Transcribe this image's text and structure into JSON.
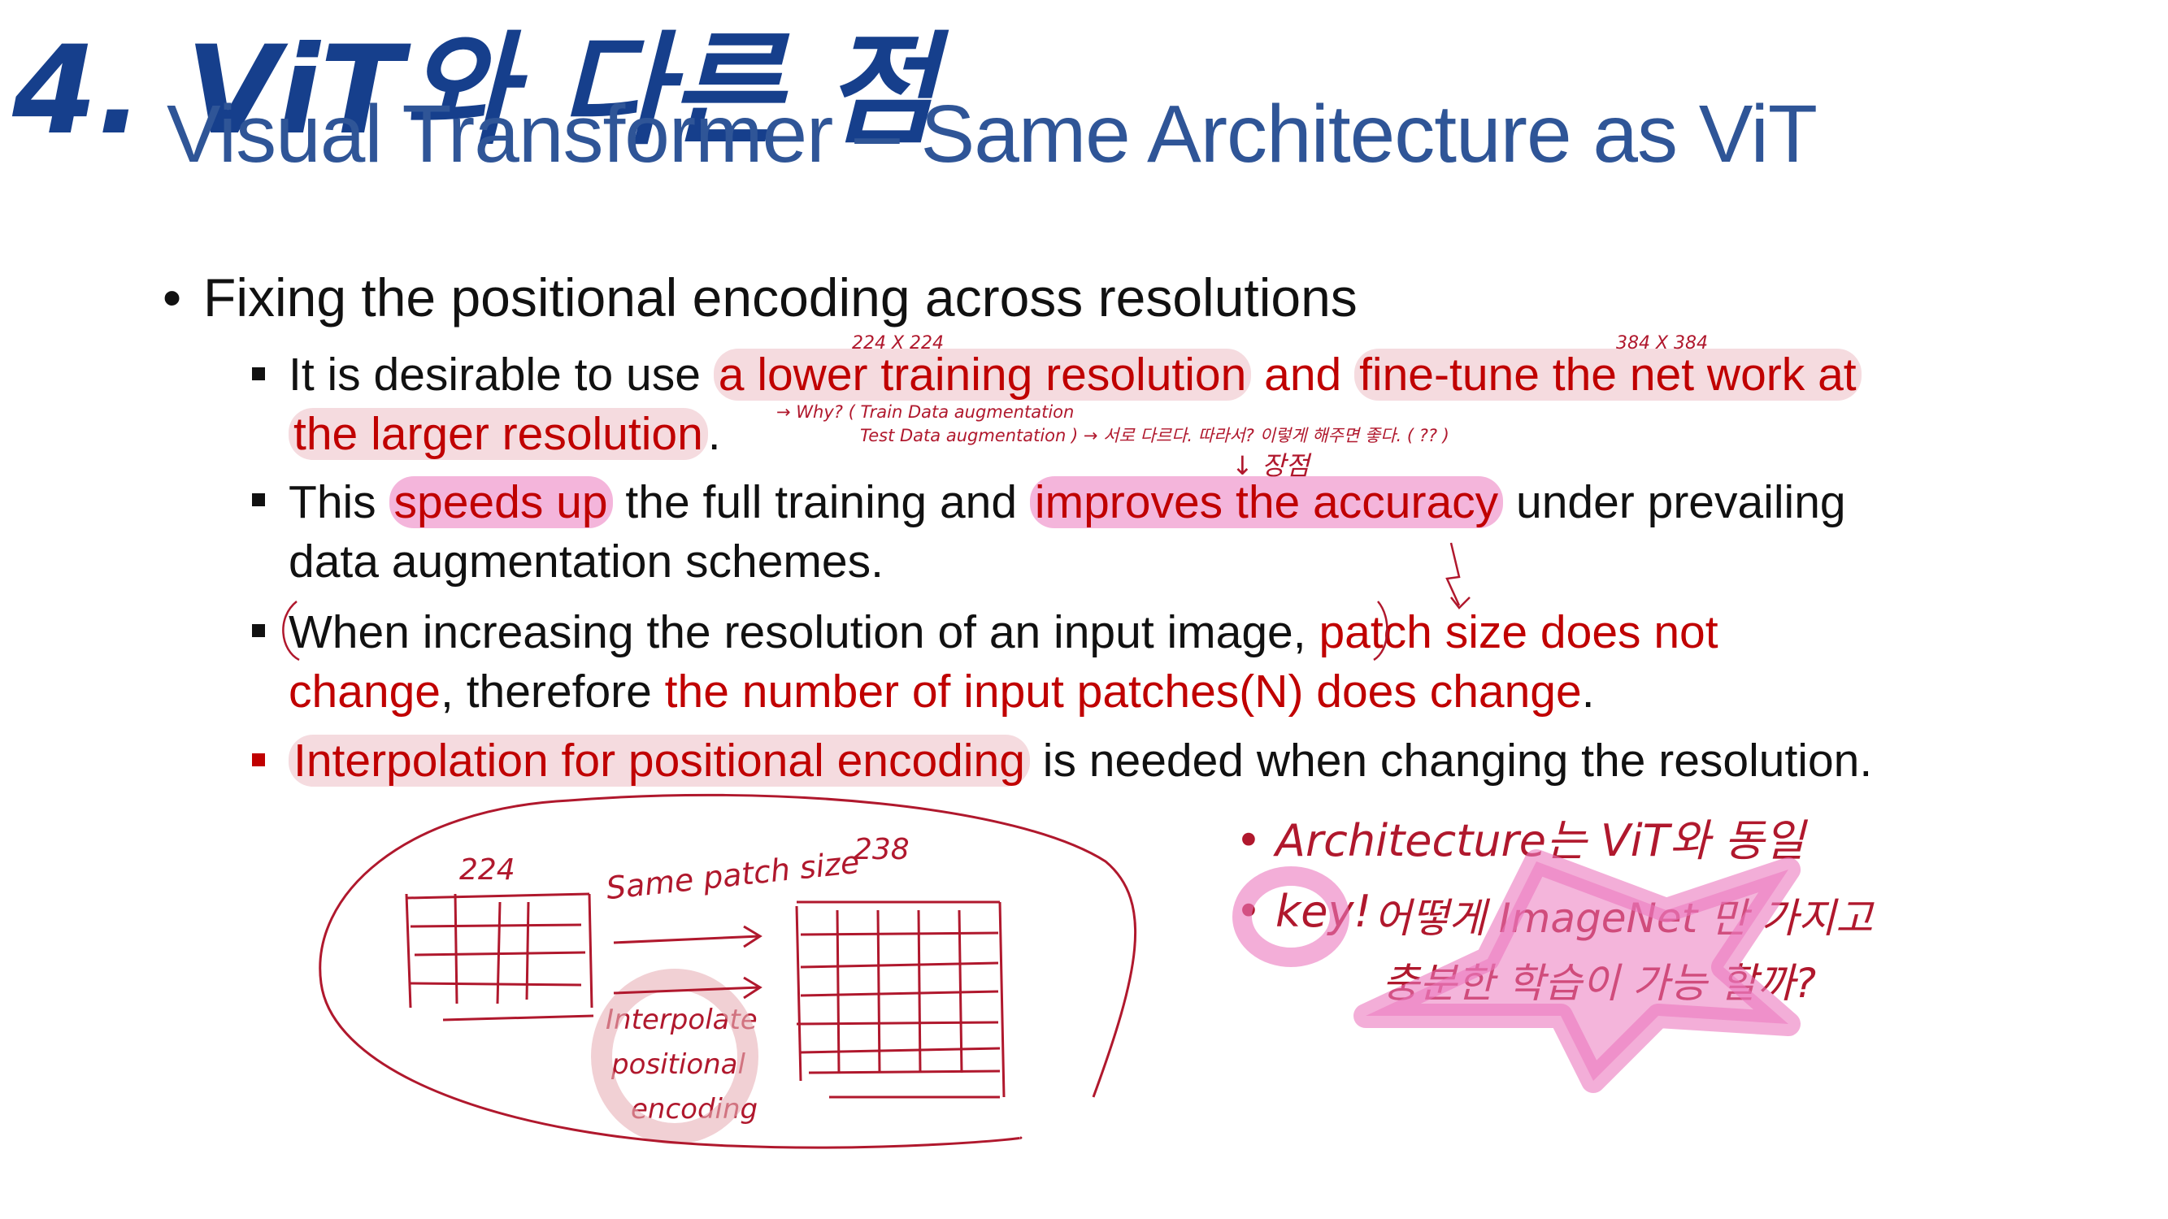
{
  "handwritten_heading": "4. ViT와 다른 점",
  "slide_title": "Visual Transformer – Same Architecture as ViT",
  "main_bullet": "Fixing the positional encoding across resolutions",
  "sub1": {
    "prefix": "It is desirable to use ",
    "hl1": "a lower training resolution",
    "and": " and ",
    "hl2": "fine-tune the net work at",
    "line2_hl": "the larger resolution",
    "end": "."
  },
  "sub2": {
    "prefix": "This ",
    "hl1": "speeds up",
    "mid": " the full training and ",
    "hl2": "improves the accuracy",
    "suffix": " under prevailing",
    "line2": "data augmentation schemes."
  },
  "sub3": {
    "prefix": "When increasing the resolution of an input image",
    "comma": ", ",
    "red1": "patch size does not",
    "red2": "change",
    "mid": ", therefore ",
    "red3": "the number of input patches(N) does change",
    "end": "."
  },
  "sub4": {
    "hl": "Interpolation for positional encoding",
    "suffix": " is needed when changing the resolution."
  },
  "annotations": {
    "res_low": "224 X 224",
    "res_high": "384 X 384",
    "why": "→ Why? ( Train  Data augmentation",
    "test": "Test  Data augmentation ) → 서로 다르다. 따라서? 이렇게 해주면 좋다. ( ?? )",
    "merit": "↓ 장점",
    "left_size": "224",
    "same_patch": "Same patch size",
    "right_size": "238",
    "interp1": "Interpolate",
    "interp2": "positional",
    "interp3": "encoding",
    "arch": "• Architecture는  ViT와  동일",
    "key": "• key!",
    "q1": "어떻게  ImageNet 만  가지고",
    "q2": "충분한  학습이  가능  할까?"
  },
  "colors": {
    "title": "#2f5597",
    "heading_ink": "#163f8c",
    "red_text": "#c00000",
    "pink_highlight": "#eb78be",
    "light_highlight": "#e8b0b8",
    "pen": "#b0182d"
  }
}
